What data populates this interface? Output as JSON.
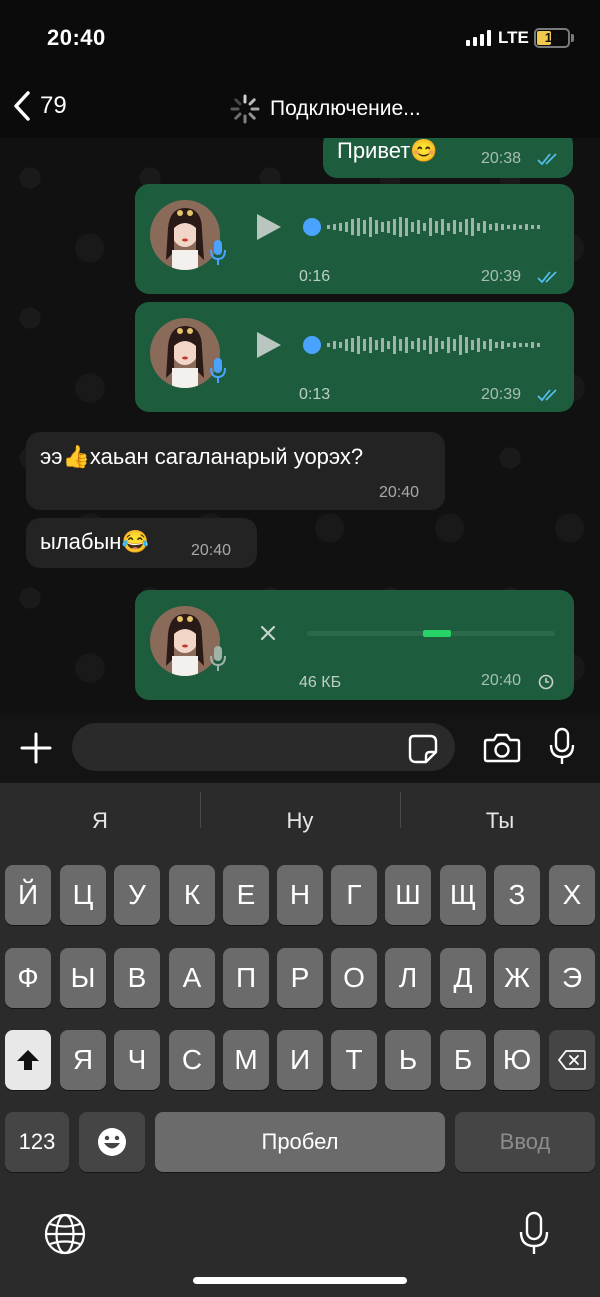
{
  "status": {
    "time": "20:40",
    "network": "LTE",
    "battery": "14",
    "battery_color": "#f2c94c"
  },
  "header": {
    "back_count": "79",
    "connection_status": "Подключение..."
  },
  "messages": [
    {
      "type": "text",
      "direction": "outgoing",
      "text": "Привет😊",
      "time": "20:38",
      "status": "read"
    },
    {
      "type": "voice",
      "direction": "outgoing",
      "duration": "0:16",
      "time": "20:39",
      "status": "read"
    },
    {
      "type": "voice",
      "direction": "outgoing",
      "duration": "0:13",
      "time": "20:39",
      "status": "read"
    },
    {
      "type": "text",
      "direction": "incoming",
      "text": "ээ👍хаьан сагаланарый уорэх?",
      "time": "20:40"
    },
    {
      "type": "text",
      "direction": "incoming",
      "text": "ылабын😂",
      "time": "20:40"
    },
    {
      "type": "voice-uploading",
      "direction": "outgoing",
      "size": "46 КБ",
      "time": "20:40",
      "status": "pending"
    }
  ],
  "input": {
    "placeholder": ""
  },
  "keyboard": {
    "suggestions": [
      "Я",
      "Ну",
      "Ты"
    ],
    "row1": [
      "Й",
      "Ц",
      "У",
      "К",
      "Е",
      "Н",
      "Г",
      "Ш",
      "Щ",
      "З",
      "Х"
    ],
    "row2": [
      "Ф",
      "Ы",
      "В",
      "А",
      "П",
      "Р",
      "О",
      "Л",
      "Д",
      "Ж",
      "Э"
    ],
    "row3": [
      "Я",
      "Ч",
      "С",
      "М",
      "И",
      "Т",
      "Ь",
      "Б",
      "Ю"
    ],
    "numbers_label": "123",
    "space_label": "Пробел",
    "enter_label": "Ввод"
  },
  "colors": {
    "outgoing_bubble": "#1d5c3d",
    "incoming_bubble": "#232323",
    "accent_blue": "#4aa3ff",
    "tick_blue": "#53bdeb",
    "upload_green": "#25d366"
  }
}
